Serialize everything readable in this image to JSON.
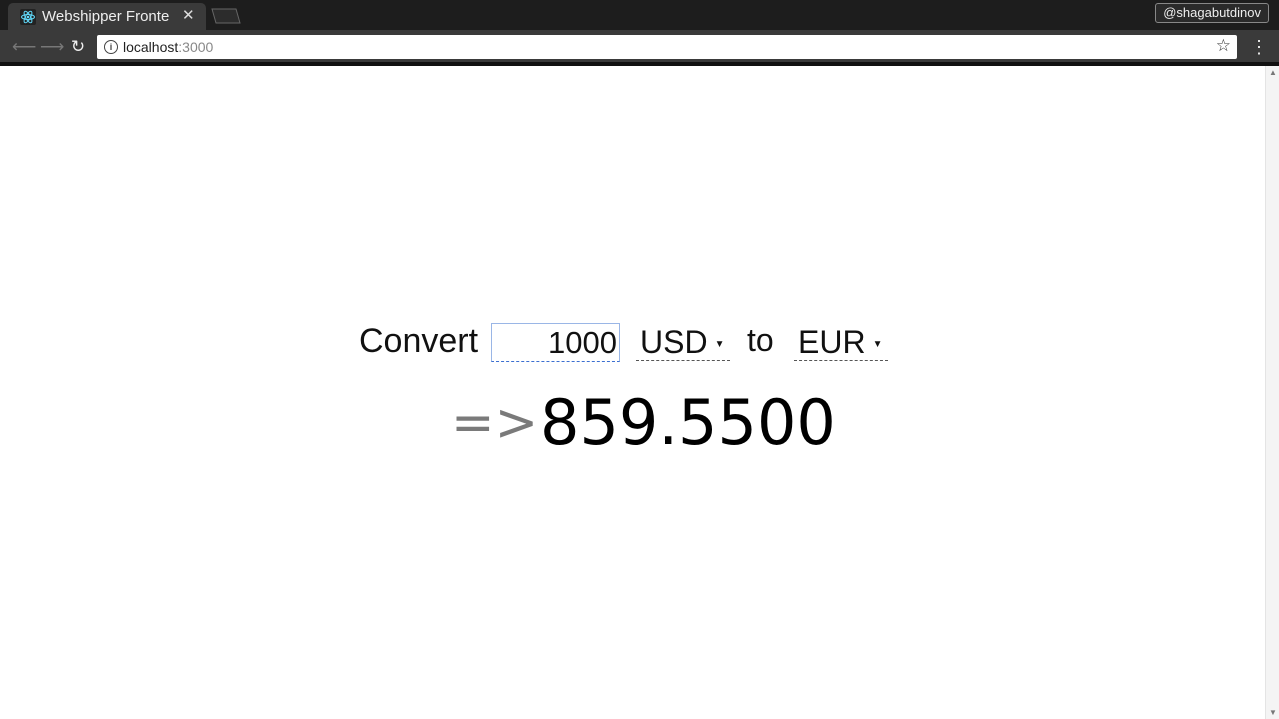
{
  "browser": {
    "tab_title": "Webshipper Fronte",
    "profile_name": "@shagabutdinov",
    "url_host": "localhost",
    "url_port": ":3000",
    "icons": {
      "favicon": "react-logo-icon",
      "close": "close-icon",
      "back": "arrow-left-icon",
      "forward": "arrow-right-icon",
      "reload": "reload-icon",
      "info": "info-icon",
      "bookmark": "star-icon",
      "menu": "kebab-menu-icon"
    }
  },
  "converter": {
    "convert_label": "Convert",
    "amount_value": "1000",
    "from_currency": "USD",
    "to_label": "to",
    "to_currency": "EUR",
    "arrow_text": "=>",
    "result_value": "859.5500"
  }
}
